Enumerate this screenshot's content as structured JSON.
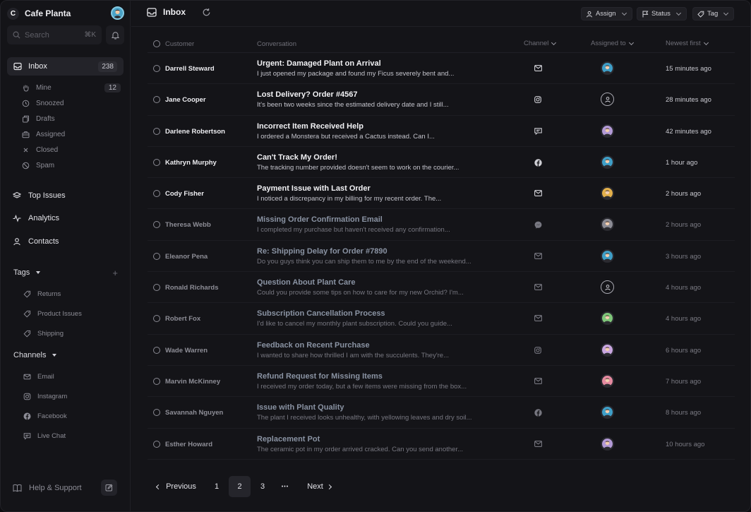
{
  "app": {
    "brand_initial": "C",
    "brand_name": "Cafe Planta"
  },
  "search": {
    "label": "Search",
    "shortcut": "⌘K"
  },
  "sidebar": {
    "inbox": {
      "label": "Inbox",
      "count": "238"
    },
    "inbox_sub": [
      {
        "label": "Mine",
        "count": "12",
        "icon": "hand-icon"
      },
      {
        "label": "Snoozed",
        "icon": "clock-icon"
      },
      {
        "label": "Drafts",
        "icon": "drafts-icon"
      },
      {
        "label": "Assigned",
        "icon": "briefcase-icon"
      },
      {
        "label": "Closed",
        "icon": "x-icon"
      },
      {
        "label": "Spam",
        "icon": "ban-icon"
      }
    ],
    "sections": [
      {
        "label": "Top Issues",
        "icon": "layers-icon"
      },
      {
        "label": "Analytics",
        "icon": "pulse-icon"
      },
      {
        "label": "Contacts",
        "icon": "user-icon"
      }
    ],
    "tags_label": "Tags",
    "tags": [
      "Returns",
      "Product Issues",
      "Shipping"
    ],
    "channels_label": "Channels",
    "channels": [
      "Email",
      "Instagram",
      "Facebook",
      "Live Chat"
    ],
    "help_label": "Help & Support"
  },
  "topbar": {
    "title": "Inbox",
    "assign_label": "Assign",
    "status_label": "Status",
    "tag_label": "Tag"
  },
  "table": {
    "headers": {
      "customer": "Customer",
      "conversation": "Conversation",
      "channel": "Channel",
      "assigned": "Assigned to",
      "sort": "Newest first"
    },
    "rows": [
      {
        "customer": "Darrell Steward",
        "subject": "Urgent: Damaged Plant on Arrival",
        "preview": "I just opened my package and found my Ficus severely bent and...",
        "channel": "email",
        "avatar": "#3f9fc8",
        "time": "15 minutes ago",
        "read": false
      },
      {
        "customer": "Jane Cooper",
        "subject": "Lost Delivery? Order #4567",
        "preview": "It's been two weeks since the estimated delivery date and I still...",
        "channel": "instagram",
        "avatar": "none",
        "time": "28 minutes ago",
        "read": false
      },
      {
        "customer": "Darlene Robertson",
        "subject": "Incorrect Item Received Help",
        "preview": "I ordered a Monstera but received a Cactus instead. Can I...",
        "channel": "chat",
        "avatar": "#b39ad6",
        "time": "42 minutes ago",
        "read": false
      },
      {
        "customer": "Kathryn Murphy",
        "subject": "Can't Track My Order!",
        "preview": "The tracking number provided doesn't seem to work on the courier...",
        "channel": "facebook",
        "avatar": "#3f9fc8",
        "time": "1 hour ago",
        "read": false
      },
      {
        "customer": "Cody Fisher",
        "subject": "Payment Issue with Last Order",
        "preview": "I noticed a discrepancy in my billing for my recent order. The...",
        "channel": "email",
        "avatar": "#e3b04b",
        "time": "2 hours ago",
        "read": false
      },
      {
        "customer": "Theresa Webb",
        "subject": "Missing Order Confirmation Email",
        "preview": "I completed my purchase but haven't received any confirmation...",
        "channel": "messenger",
        "avatar": "#8c8c95",
        "time": "2 hours ago",
        "read": true
      },
      {
        "customer": "Eleanor Pena",
        "subject": "Re: Shipping Delay for Order #7890",
        "preview": "Do you guys think you can ship them to me by the end of the weekend...",
        "channel": "email",
        "avatar": "#3f9fc8",
        "time": "3 hours ago",
        "read": true
      },
      {
        "customer": "Ronald Richards",
        "subject": "Question About Plant Care",
        "preview": "Could you provide some tips on how to care for my new Orchid? I'm...",
        "channel": "email",
        "avatar": "none",
        "time": "4 hours ago",
        "read": true
      },
      {
        "customer": "Robert Fox",
        "subject": "Subscription Cancellation Process",
        "preview": "I'd like to cancel my monthly plant subscription. Could you guide...",
        "channel": "email",
        "avatar": "#7fc77a",
        "time": "4 hours ago",
        "read": true
      },
      {
        "customer": "Wade Warren",
        "subject": "Feedback on Recent Purchase",
        "preview": "I wanted to share how thrilled I am with the succulents. They're...",
        "channel": "instagram",
        "avatar": "#c9a6e0",
        "time": "6 hours ago",
        "read": true
      },
      {
        "customer": "Marvin McKinney",
        "subject": "Refund Request for Missing Items",
        "preview": "I received my order today, but a few items were missing from the box...",
        "channel": "email",
        "avatar": "#e58aa0",
        "time": "7 hours ago",
        "read": true
      },
      {
        "customer": "Savannah Nguyen",
        "subject": "Issue with Plant Quality",
        "preview": "The plant I received looks unhealthy, with yellowing leaves and dry soil...",
        "channel": "facebook",
        "avatar": "#3f9fc8",
        "time": "8 hours ago",
        "read": true
      },
      {
        "customer": "Esther Howard",
        "subject": "Replacement Pot",
        "preview": "The ceramic pot in my order arrived cracked. Can you send another...",
        "channel": "email",
        "avatar": "#b39ad6",
        "time": "10 hours ago",
        "read": true
      }
    ]
  },
  "pagination": {
    "previous": "Previous",
    "pages": [
      "1",
      "2",
      "3"
    ],
    "current": "2",
    "ellipsis": "•••",
    "next": "Next"
  },
  "colors": {
    "background": "#141418",
    "active_nav": "#232329",
    "text": "#e6e6ea",
    "muted": "#8c8c95"
  }
}
